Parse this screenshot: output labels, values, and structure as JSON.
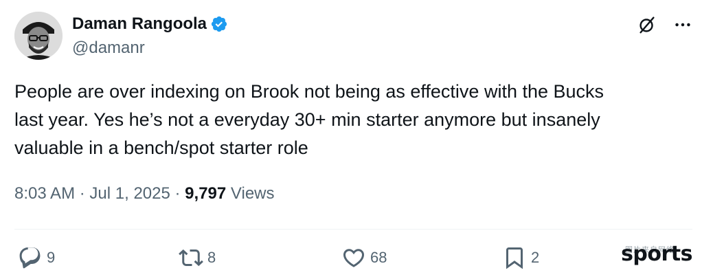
{
  "author": {
    "display_name": "Daman Rangoola",
    "handle": "@damanr",
    "verified": true,
    "verified_color": "#1d9bf0"
  },
  "header_icons": [
    "grok-icon",
    "more-icon"
  ],
  "tweet": {
    "text_lines": [
      "People are over indexing on Brook not being as effective with the Bucks",
      "last year. Yes he’s not a everyday 30+ min starter anymore but insanely",
      "valuable in a bench/spot starter role"
    ],
    "time": "8:03 AM",
    "date": "Jul 1, 2025",
    "views_count": "9,797",
    "views_label": "Views"
  },
  "actions": {
    "replies": "9",
    "reposts": "8",
    "likes": "68",
    "bookmarks": "2"
  },
  "watermark": {
    "text": "sports",
    "faint_text": "图片来自网络"
  },
  "colors": {
    "primary_text": "#0f1419",
    "secondary_text": "#536471",
    "divider": "#eff3f4"
  }
}
